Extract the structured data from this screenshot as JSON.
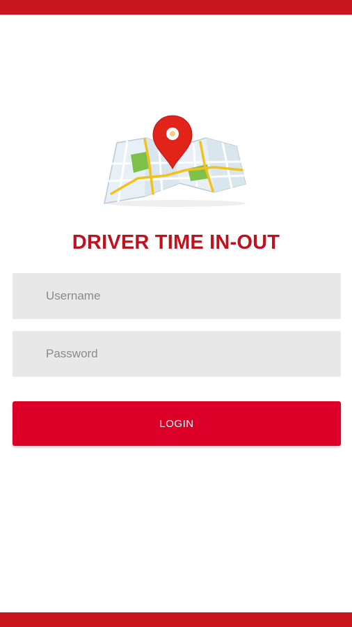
{
  "app": {
    "title": "DRIVER TIME IN-OUT"
  },
  "logo": {
    "icon": "map-pin-icon"
  },
  "form": {
    "username_placeholder": "Username",
    "username_value": "",
    "password_placeholder": "Password",
    "password_value": "",
    "login_label": "LOGIN"
  },
  "colors": {
    "accent_bar": "#c8161e",
    "title": "#c0111c",
    "button": "#dc0029",
    "field_bg": "#e8e8e8"
  }
}
